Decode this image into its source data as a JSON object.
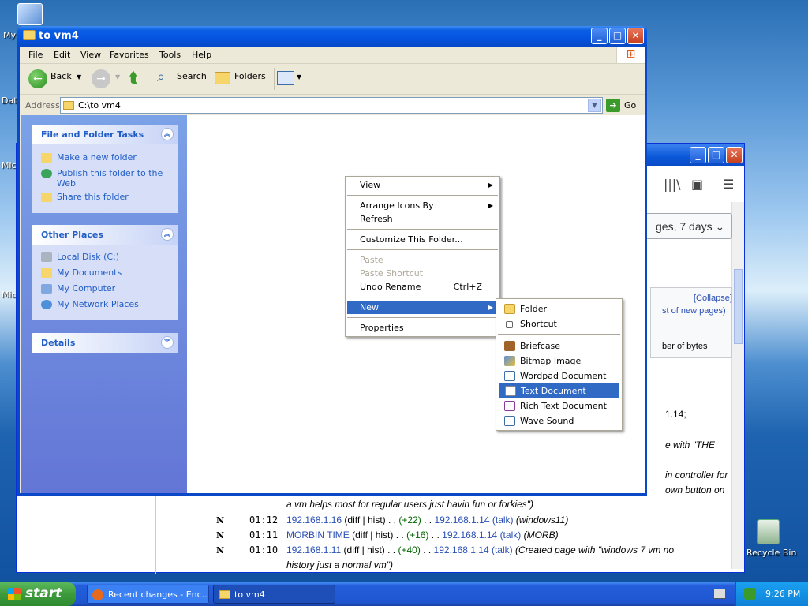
{
  "desktop": {
    "icons": [
      {
        "label": "My"
      },
      {
        "label": "Dat"
      },
      {
        "label": "Mic"
      },
      {
        "label": "Mic"
      }
    ],
    "recycle_bin": "Recycle Bin"
  },
  "browser": {
    "filter_label": "ges, 7 days",
    "collapse": "[Collapse]",
    "new_pages": "st of new pages)",
    "bytes": "ber of bytes",
    "frag1": "1.14;",
    "frag2": "e with \"THE",
    "frag3": "in controller for",
    "frag4": "own button on",
    "line0": "a vm helps most for regular users just havin fun or forkies\")",
    "rows": [
      {
        "flag": "N",
        "time": "01:12",
        "page": "192.168.1.16",
        "diff": "(diff | hist)",
        "dots": ". .",
        "size": "(+22)",
        "user": "192.168.1.14",
        "talk": "(talk)",
        "summary": "(windows11)"
      },
      {
        "flag": "N",
        "time": "01:11",
        "page": "MORBIN TIME",
        "diff": "(diff | hist)",
        "dots": ". .",
        "size": "(+16)",
        "user": "192.168.1.14",
        "talk": "(talk)",
        "summary": "(MORB)"
      },
      {
        "flag": "N",
        "time": "01:10",
        "page": "192.168.1.11",
        "diff": "(diff | hist)",
        "dots": ". .",
        "size": "(+40)",
        "user": "192.168.1.14",
        "talk": "(talk)",
        "summary": "(Created page with \"windows 7 vm no"
      }
    ],
    "line_last": "history just a normal vm\")"
  },
  "explorer": {
    "title": "to vm4",
    "menu": [
      "File",
      "Edit",
      "View",
      "Favorites",
      "Tools",
      "Help"
    ],
    "toolbar": {
      "back": "Back",
      "search": "Search",
      "folders": "Folders"
    },
    "address": {
      "label": "Address",
      "value": "C:\\to vm4",
      "go": "Go"
    },
    "tasks": {
      "title": "File and Folder Tasks",
      "items": [
        "Make a new folder",
        "Publish this folder to the",
        "Web",
        "Share this folder"
      ]
    },
    "places": {
      "title": "Other Places",
      "items": [
        "Local Disk (C:)",
        "My Documents",
        "My Computer",
        "My Network Places"
      ]
    },
    "details": {
      "title": "Details"
    }
  },
  "context_menu": {
    "view": "View",
    "arrange": "Arrange Icons By",
    "refresh": "Refresh",
    "customize": "Customize This Folder...",
    "paste": "Paste",
    "paste_shortcut": "Paste Shortcut",
    "undo": "Undo Rename",
    "undo_key": "Ctrl+Z",
    "new": "New",
    "properties": "Properties"
  },
  "submenu": {
    "items": [
      "Folder",
      "Shortcut",
      "Briefcase",
      "Bitmap Image",
      "Wordpad Document",
      "Text Document",
      "Rich Text Document",
      "Wave Sound"
    ]
  },
  "taskbar": {
    "start": "start",
    "tasks": [
      "Recent changes - Enc...",
      "to vm4"
    ],
    "clock": "9:26 PM"
  },
  "colors": {
    "selection": "#316ac5",
    "title_blue": "#0554e0",
    "link": "#2a4fb5"
  }
}
